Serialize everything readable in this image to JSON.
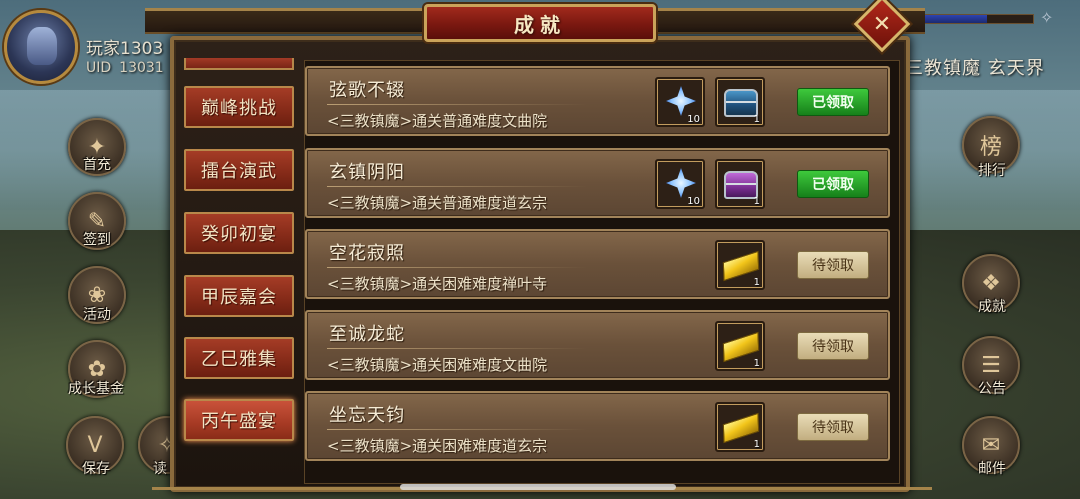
{
  "player": {
    "name": "玩家1303",
    "uid_label": "UID",
    "uid_value": "13031"
  },
  "top_right": {
    "location": "三教镇魔  玄天界",
    "bar_fill_fraction": 0.65
  },
  "panel": {
    "title": "成就",
    "close_symbol": "✕"
  },
  "left_menu": [
    {
      "label": "首充",
      "glyph": "✦"
    },
    {
      "label": "签到",
      "glyph": "✎"
    },
    {
      "label": "活动",
      "glyph": "❀"
    },
    {
      "label": "成长基金",
      "glyph": "✿"
    },
    {
      "label": "保存",
      "glyph": "V"
    },
    {
      "label": "读",
      "glyph": "✧"
    }
  ],
  "right_menu": [
    {
      "label": "排行",
      "glyph": "榜"
    },
    {
      "label": "成就",
      "glyph": "❖"
    },
    {
      "label": "公告",
      "glyph": "☰"
    },
    {
      "label": "邮件",
      "glyph": "✉"
    }
  ],
  "categories": [
    {
      "label": "巅峰挑战",
      "active": false
    },
    {
      "label": "擂台演武",
      "active": false
    },
    {
      "label": "癸卯初宴",
      "active": false
    },
    {
      "label": "甲辰嘉会",
      "active": false
    },
    {
      "label": "乙巳雅集",
      "active": false
    },
    {
      "label": "丙午盛宴",
      "active": true
    }
  ],
  "achievements": [
    {
      "title": "弦歌不辍",
      "desc": "<三教镇魔>通关普通难度文曲院",
      "rewards": [
        {
          "icon": "crystal-icon",
          "count": "10"
        },
        {
          "icon": "blue-chest-icon",
          "count": "1"
        }
      ],
      "status": "已领取",
      "claimed": true
    },
    {
      "title": "玄镇阴阳",
      "desc": "<三教镇魔>通关普通难度道玄宗",
      "rewards": [
        {
          "icon": "crystal-icon",
          "count": "10"
        },
        {
          "icon": "purple-chest-icon",
          "count": "1"
        }
      ],
      "status": "已领取",
      "claimed": true
    },
    {
      "title": "空花寂照",
      "desc": "<三教镇魔>通关困难难度禅叶寺",
      "rewards": [
        {
          "icon": "gold-bar-icon",
          "count": "1"
        }
      ],
      "status": "待领取",
      "claimed": false
    },
    {
      "title": "至诚龙蛇",
      "desc": "<三教镇魔>通关困难难度文曲院",
      "rewards": [
        {
          "icon": "gold-bar-icon",
          "count": "1"
        }
      ],
      "status": "待领取",
      "claimed": false
    },
    {
      "title": "坐忘天钧",
      "desc": "<三教镇魔>通关困难难度道玄宗",
      "rewards": [
        {
          "icon": "gold-bar-icon",
          "count": "1"
        }
      ],
      "status": "待领取",
      "claimed": false
    }
  ]
}
